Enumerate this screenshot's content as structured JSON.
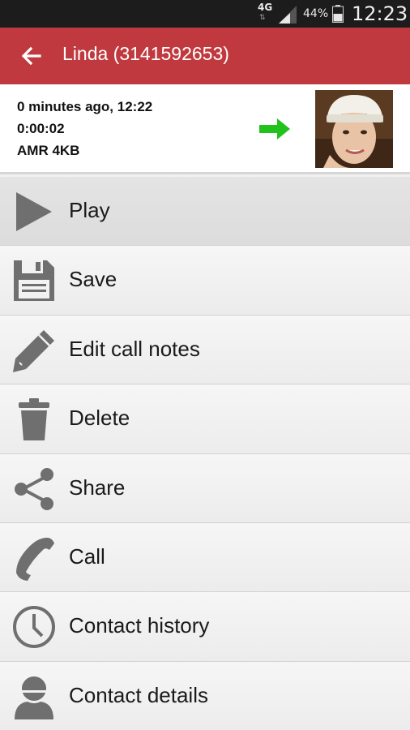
{
  "status_bar": {
    "network": "4G",
    "battery_percent": "44%",
    "time": "12:23"
  },
  "app_bar": {
    "title": "Linda (3141592653)",
    "back_icon": "arrow-left-icon"
  },
  "recording": {
    "when": "0 minutes ago, 12:22",
    "duration": "0:00:02",
    "format": "AMR 4KB",
    "direction_icon": "outgoing-arrow-icon",
    "direction_color": "#22c21c"
  },
  "menu": {
    "items": [
      {
        "label": "Play",
        "icon": "play-icon"
      },
      {
        "label": "Save",
        "icon": "save-icon"
      },
      {
        "label": "Edit call notes",
        "icon": "pencil-icon"
      },
      {
        "label": "Delete",
        "icon": "trash-icon"
      },
      {
        "label": "Share",
        "icon": "share-icon"
      },
      {
        "label": "Call",
        "icon": "phone-icon"
      },
      {
        "label": "Contact history",
        "icon": "clock-icon"
      },
      {
        "label": "Contact details",
        "icon": "person-icon"
      }
    ]
  },
  "colors": {
    "accent": "#c0393e",
    "icon_gray": "#6f6f6f"
  }
}
